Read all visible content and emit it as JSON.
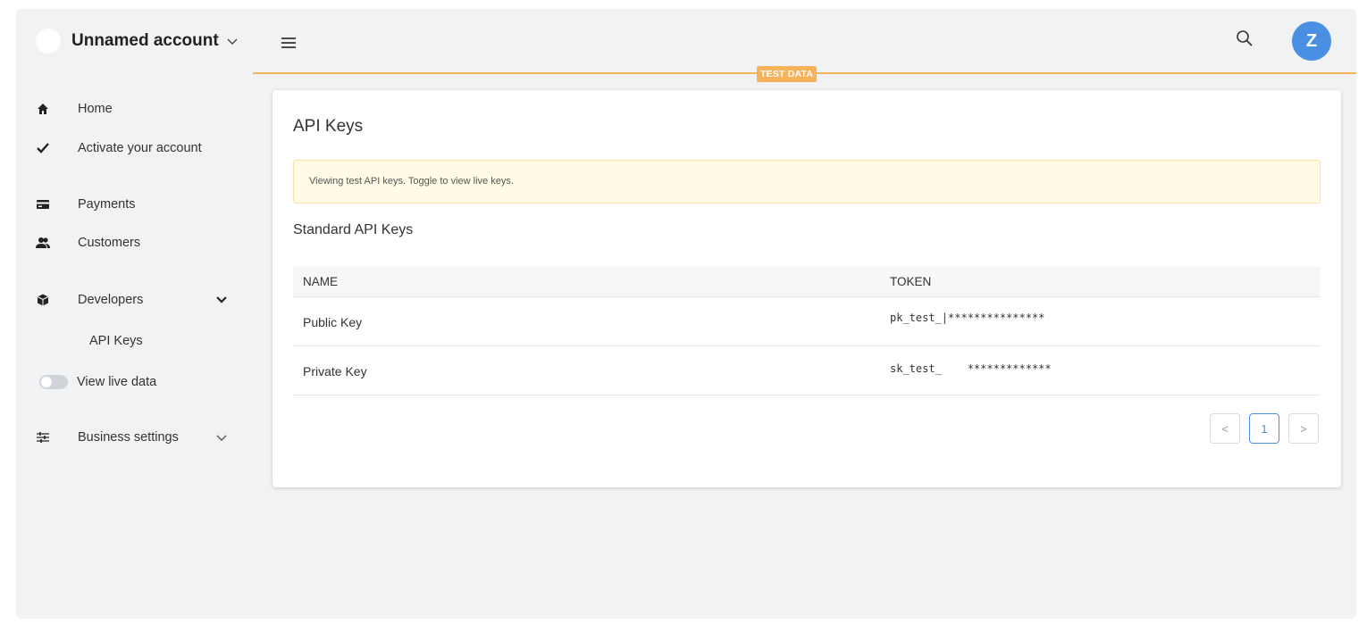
{
  "account": {
    "name": "Unnamed account"
  },
  "sidebar": {
    "items": [
      {
        "label": "Home",
        "icon": "home-icon"
      },
      {
        "label": "Activate your account",
        "icon": "check-icon"
      },
      {
        "label": "Payments",
        "icon": "credit-card-icon"
      },
      {
        "label": "Customers",
        "icon": "users-icon"
      },
      {
        "label": "Developers",
        "icon": "cube-icon"
      },
      {
        "label": "View live data",
        "icon": "toggle-icon"
      },
      {
        "label": "Business settings",
        "icon": "sliders-icon"
      }
    ],
    "developers_sub": {
      "label": "API Keys"
    },
    "live_toggle_on": false
  },
  "header": {
    "avatar_initial": "Z",
    "test_badge": "TEST DATA",
    "accent": "#f8b35a",
    "primary": "#4a90e2"
  },
  "main": {
    "title": "API Keys",
    "notice": "Viewing test API keys. Toggle to view live keys.",
    "section_title": "Standard API Keys",
    "table": {
      "headers": [
        "NAME",
        "TOKEN"
      ],
      "rows": [
        {
          "name": "Public Key",
          "token": "pk_test_|***************"
        },
        {
          "name": "Private Key",
          "token": "sk_test_    *************"
        }
      ]
    },
    "pagination": {
      "prev": "<",
      "current": "1",
      "next": ">"
    }
  }
}
